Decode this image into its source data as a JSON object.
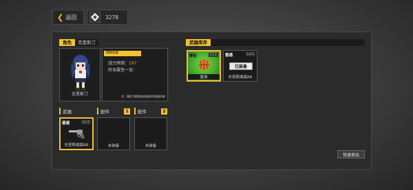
{
  "hud": {
    "back_label": "返回",
    "currency_value": "3278"
  },
  "character": {
    "section_label": "角色",
    "name": "克里斯汀",
    "name_caption": "克里斯汀",
    "badge_text": "特殊技能",
    "combat_label": "战力预测：",
    "combat_value": "197",
    "attributes_label": "所含属性一览：",
    "note": "注：属性可解锁该技能树的超级技能"
  },
  "slots": {
    "weapon_label": "武器",
    "part1_label": "配件",
    "part1_num": "1",
    "part2_label": "配件",
    "part2_num": "2",
    "weapon_rarity": "普通",
    "weapon_level": "Lv.1",
    "weapon_name": "史密斯威森R8",
    "empty_label": "未装备"
  },
  "inventory": {
    "section_label": "武器库存",
    "items": [
      {
        "rarity": "稀有",
        "level": "Lv.1",
        "name": "篮球"
      },
      {
        "rarity": "普通",
        "level": "Lv.1",
        "status": "已装备",
        "name": "史密斯威森R8"
      }
    ]
  },
  "quick_sell_label": "快速卖出",
  "colors": {
    "accent": "#f2c230",
    "rare_green": "#4fc22b",
    "panel": "#2b2b2b"
  }
}
